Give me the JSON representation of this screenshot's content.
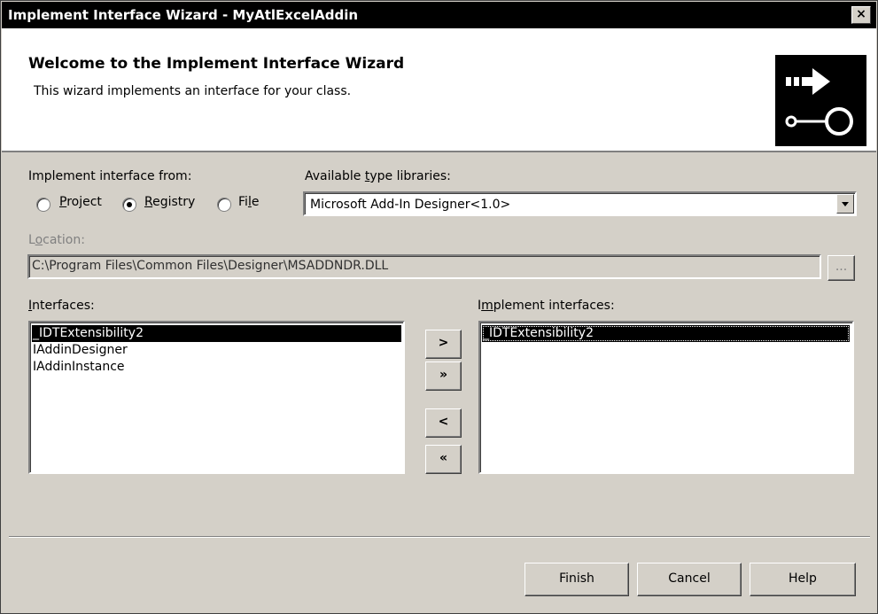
{
  "window": {
    "title": "Implement Interface Wizard - MyAtlExcelAddin",
    "close_glyph": "×"
  },
  "header": {
    "title": "Welcome to the Implement Interface Wizard",
    "subtitle": "This wizard implements an interface for your class.",
    "logo_icon": "wizard-arrow-lollipop-icon"
  },
  "implement_from": {
    "label": "Implement interface from:",
    "options": [
      {
        "label": "Project",
        "accel": "P",
        "rest": "roject",
        "selected": false
      },
      {
        "label": "Registry",
        "accel": "R",
        "rest": "egistry",
        "selected": true
      },
      {
        "label": "File",
        "pre": "Fi",
        "accel": "l",
        "rest": "e",
        "selected": false
      }
    ]
  },
  "type_libraries": {
    "label_pre": "Available ",
    "label_accel": "t",
    "label_rest": "ype libraries:",
    "selected": "Microsoft Add-In Designer<1.0>"
  },
  "location": {
    "label_pre": "L",
    "label_accel": "o",
    "label_rest": "cation:",
    "value": "C:\\Program Files\\Common Files\\Designer\\MSADDNDR.DLL",
    "browse_label": "..."
  },
  "interfaces": {
    "label_accel": "I",
    "label_rest": "nterfaces:",
    "items": [
      "_IDTExtensibility2",
      "IAddinDesigner",
      "IAddinInstance"
    ],
    "selected_index": 0
  },
  "move_buttons": {
    "add": ">",
    "add_all": "»",
    "remove": "<",
    "remove_all": "«"
  },
  "implement_interfaces": {
    "label_pre": "I",
    "label_accel": "m",
    "label_rest": "plement interfaces:",
    "items": [
      "_IDTExtensibility2"
    ]
  },
  "footer": {
    "finish": "Finish",
    "cancel": "Cancel",
    "help": "Help"
  },
  "colors": {
    "face": "#d4d0c8",
    "selection": "#000000",
    "header_bg": "#ffffff"
  }
}
